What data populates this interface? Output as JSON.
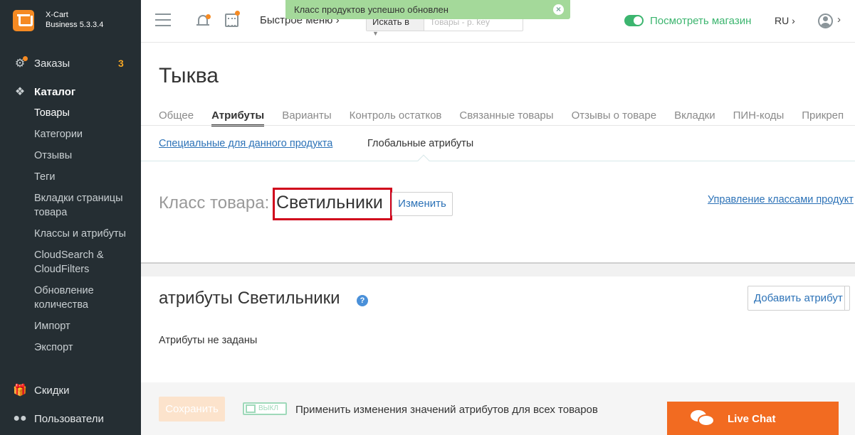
{
  "brand": {
    "name": "X-Cart",
    "version": "Business 5.3.3.4",
    "accent": "#f58a23"
  },
  "topbar": {
    "quick_menu": "Быстрое меню",
    "search_select": "Искать в",
    "search_placeholder": "Товары - р. key",
    "view_store": "Посмотреть магазин",
    "language": "RU"
  },
  "notification": {
    "text": "Класс продуктов успешно обновлен",
    "close": "×"
  },
  "sidebar": {
    "orders": {
      "label": "Заказы",
      "count": "3"
    },
    "catalog": {
      "label": "Каталог"
    },
    "catalog_items": [
      "Товары",
      "Категории",
      "Отзывы",
      "Теги",
      "Вкладки страницы товара",
      "Классы и атрибуты",
      "CloudSearch & CloudFilters",
      "Обновление количества",
      "Импорт",
      "Экспорт"
    ],
    "discounts": {
      "label": "Скидки"
    },
    "users": {
      "label": "Пользователи"
    }
  },
  "page": {
    "title": "Тыква",
    "tabs": [
      "Общее",
      "Атрибуты",
      "Варианты",
      "Контроль остатков",
      "Связанные товары",
      "Отзывы о товаре",
      "Вкладки",
      "ПИН-коды",
      "Прикреп"
    ],
    "active_tab": "Атрибуты",
    "subtabs": {
      "specific": "Специальные для данного продукта",
      "global": "Глобальные атрибуты"
    },
    "class_label": "Класс товара:",
    "class_value": "Светильники",
    "change_button": "Изменить",
    "manage_link": "Управление классами продукт",
    "attributes_title": "атрибуты Светильники",
    "help": "?",
    "add_attribute": "Добавить атрибут",
    "no_attributes": "Атрибуты не заданы",
    "save_button": "Сохранить",
    "switch_label": "ВЫКЛ",
    "apply_label": "Применить изменения значений атрибутов для всех товаров"
  },
  "live_chat": {
    "label": "Live Chat",
    "color": "#f26b21"
  }
}
